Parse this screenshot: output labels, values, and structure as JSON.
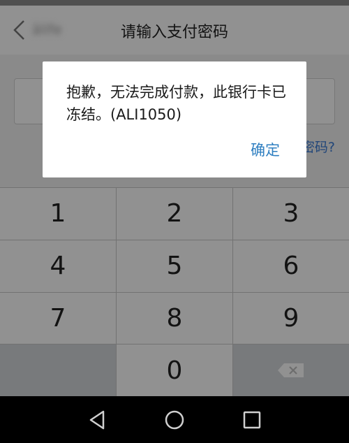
{
  "header": {
    "title": "请输入支付密码",
    "back_label": "ālife"
  },
  "forgot_link": "密码?",
  "keypad": {
    "keys": [
      "1",
      "2",
      "3",
      "4",
      "5",
      "6",
      "7",
      "8",
      "9",
      "",
      "0",
      "delete-icon"
    ]
  },
  "dialog": {
    "message": "抱歉，无法完成付款，此银行卡已冻结。(ALI1050)",
    "confirm_label": "确定"
  },
  "nav_bar": {
    "icons": [
      "back-triangle-icon",
      "home-circle-icon",
      "recents-square-icon"
    ]
  },
  "colors": {
    "link": "#3a7bd5",
    "confirm": "#2f7fc1",
    "dim_overlay": "rgba(0,0,0,0.43)"
  }
}
